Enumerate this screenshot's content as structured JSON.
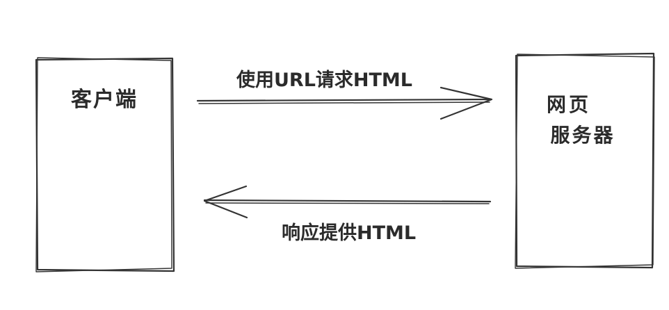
{
  "nodes": {
    "client": {
      "label": "客户端"
    },
    "server": {
      "label_line1": "网页",
      "label_line2": "服务器"
    }
  },
  "edges": {
    "request": {
      "label": "使用URL请求HTML"
    },
    "response": {
      "label": "响应提供HTML"
    }
  },
  "colors": {
    "stroke": "#333333",
    "text": "#2b2b2b",
    "background": "#ffffff"
  }
}
